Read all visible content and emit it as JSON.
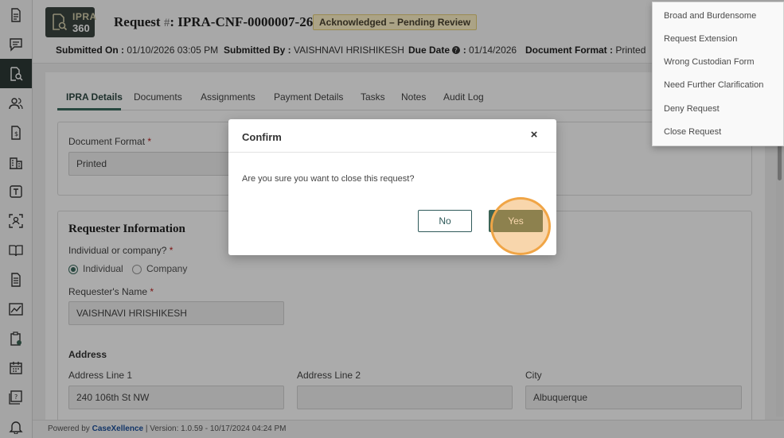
{
  "app": {
    "logo_line1": "IPRA",
    "logo_line2": "360"
  },
  "header": {
    "title_label": "Request ",
    "title_hash": "#",
    "title_sep": ": ",
    "request_number": "IPRA-CNF-0000007-26",
    "status_badge": "Acknowledged – Pending Review",
    "submitted_on_label": "Submitted On : ",
    "submitted_on": "01/10/2026 03:05 PM",
    "submitted_by_label": "Submitted By : ",
    "submitted_by": "VAISHNAVI HRISHIKESH",
    "due_date_label": "Due Date",
    "due_date_sep": " : ",
    "due_date": "01/14/2026",
    "doc_format_label": "Document Format : ",
    "doc_format": "Printed"
  },
  "tabs": [
    "IPRA Details",
    "Documents",
    "Assignments",
    "Payment Details",
    "Tasks",
    "Notes",
    "Audit Log"
  ],
  "form": {
    "document_format_label": "Document Format",
    "document_format_value": "Printed",
    "requester_section": "Requester Information",
    "individual_or_company_label": "Individual or company?",
    "opt_individual": "Individual",
    "opt_company": "Company",
    "requester_name_label": "Requester's Name",
    "requester_name_value": "VAISHNAVI HRISHIKESH",
    "address_section": "Address",
    "address_line1_label": "Address Line 1",
    "address_line1_value": "240 106th St NW",
    "address_line2_label": "Address Line 2",
    "address_line2_value": "",
    "city_label": "City",
    "city_value": "Albuquerque",
    "required_mark": " *"
  },
  "menu": {
    "items": [
      "Broad and Burdensome",
      "Request Extension",
      "Wrong Custodian Form",
      "Need Further Clarification",
      "Deny Request",
      "Close Request"
    ]
  },
  "modal": {
    "title": "Confirm",
    "close_glyph": "×",
    "message": "Are you sure you want to close this request?",
    "no_label": "No",
    "yes_label": "Yes"
  },
  "footer": {
    "powered_by": "Powered by ",
    "brand": "CaseXellence",
    "version": "  |  Version: 1.0.59 - 10/17/2024 04:24 PM"
  },
  "colors": {
    "accent": "#3d6455",
    "badge_bg": "#fff3c8",
    "highlight": "#f0a546"
  }
}
